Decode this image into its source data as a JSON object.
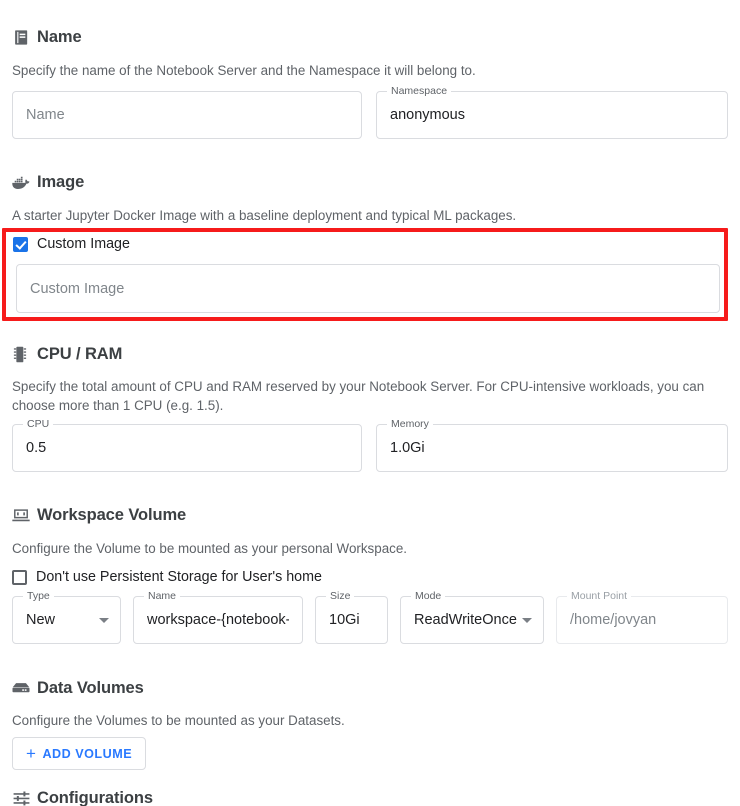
{
  "sections": {
    "name": {
      "icon": "book-icon",
      "title": "Name",
      "description": "Specify the name of the Notebook Server and the Namespace it will belong to.",
      "fields": {
        "name": {
          "label": "",
          "placeholder": "Name",
          "value": ""
        },
        "namespace": {
          "label": "Namespace",
          "placeholder": "",
          "value": "anonymous"
        }
      }
    },
    "image": {
      "icon": "docker-whale-icon",
      "title": "Image",
      "description": "A starter Jupyter Docker Image with a baseline deployment and typical ML packages.",
      "custom_image_checkbox": {
        "label": "Custom Image",
        "checked": true
      },
      "custom_image_field": {
        "label": "",
        "placeholder": "Custom Image",
        "value": ""
      },
      "highlight_color": "#f61b1b"
    },
    "cpu_ram": {
      "icon": "memory-chip-icon",
      "title": "CPU / RAM",
      "description": "Specify the total amount of CPU and RAM reserved by your Notebook Server. For CPU-intensive workloads, you can choose more than 1 CPU (e.g. 1.5).",
      "fields": {
        "cpu": {
          "label": "CPU",
          "value": "0.5"
        },
        "memory": {
          "label": "Memory",
          "value": "1.0Gi"
        }
      }
    },
    "workspace_volume": {
      "icon": "laptop-icon",
      "title": "Workspace Volume",
      "description": "Configure the Volume to be mounted as your personal Workspace.",
      "no_persistent_checkbox": {
        "label": "Don't use Persistent Storage for User's home",
        "checked": false
      },
      "fields": {
        "type": {
          "label": "Type",
          "value": "New",
          "dropdown": true
        },
        "name": {
          "label": "Name",
          "value": "workspace-{notebook-nam"
        },
        "size": {
          "label": "Size",
          "value": "10Gi"
        },
        "mode": {
          "label": "Mode",
          "value": "ReadWriteOnce",
          "dropdown": true
        },
        "mount_point": {
          "label": "Mount Point",
          "placeholder": "/home/jovyan",
          "disabled": true
        }
      }
    },
    "data_volumes": {
      "icon": "storage-disk-icon",
      "title": "Data Volumes",
      "description": "Configure the Volumes to be mounted as your Datasets.",
      "add_volume_button": {
        "label": "ADD VOLUME",
        "icon": "plus-icon",
        "color": "#2979ff"
      }
    },
    "configurations": {
      "icon": "sliders-icon",
      "title": "Configurations"
    }
  }
}
